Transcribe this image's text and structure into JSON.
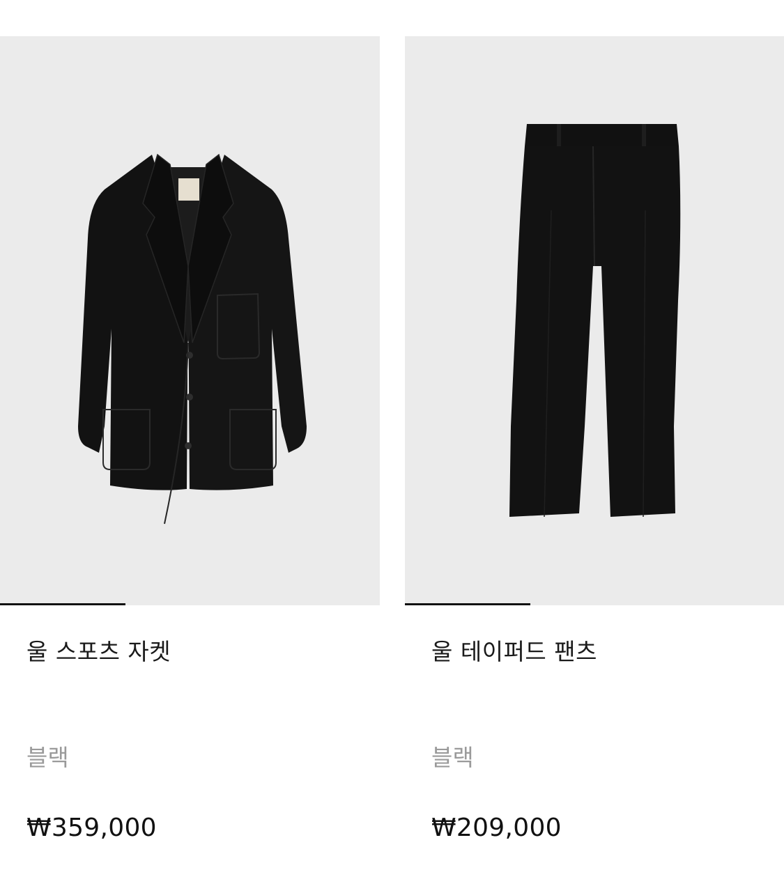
{
  "products": [
    {
      "name": "울 스포츠 자켓",
      "color": "블랙",
      "price": "₩359,000",
      "image_icon": "jacket-image",
      "image_index_progress": 0.33
    },
    {
      "name": "울 테이퍼드 팬츠",
      "color": "블랙",
      "price": "₩209,000",
      "image_icon": "pants-image",
      "image_index_progress": 0.33
    }
  ],
  "colors": {
    "image_background": "#ebebeb",
    "garment": "#121212",
    "text_primary": "#1a1a1a",
    "text_secondary": "#9a9a9a"
  }
}
